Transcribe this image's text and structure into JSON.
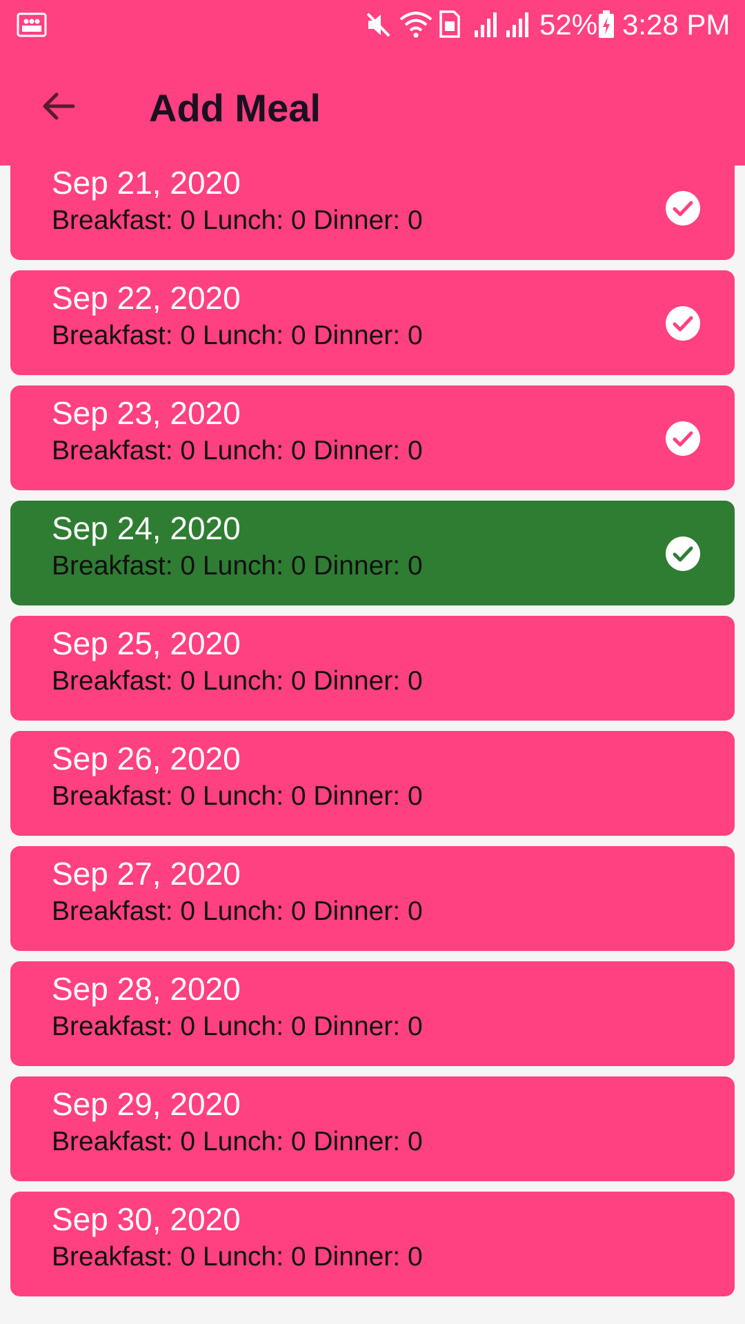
{
  "status_bar": {
    "battery": "52%",
    "time": "3:28 PM",
    "icons": [
      "photo-notification-icon",
      "mute-icon",
      "wifi-icon",
      "sim-icon",
      "signal-icon",
      "signal-icon",
      "battery-charging-icon"
    ]
  },
  "app_bar": {
    "title": "Add Meal",
    "back_icon": "arrow-back-icon"
  },
  "colors": {
    "accent": "#ff4081",
    "selected": "#2e7d32",
    "text_dark": "#111111",
    "text_light": "#ffffff"
  },
  "days": [
    {
      "date": "Sep 21, 2020",
      "meals": "Breakfast: 0 Lunch: 0 Dinner: 0",
      "checked": true,
      "selected": false
    },
    {
      "date": "Sep 22, 2020",
      "meals": "Breakfast: 0 Lunch: 0 Dinner: 0",
      "checked": true,
      "selected": false
    },
    {
      "date": "Sep 23, 2020",
      "meals": "Breakfast: 0 Lunch: 0 Dinner: 0",
      "checked": true,
      "selected": false
    },
    {
      "date": "Sep 24, 2020",
      "meals": "Breakfast: 0 Lunch: 0 Dinner: 0",
      "checked": true,
      "selected": true
    },
    {
      "date": "Sep 25, 2020",
      "meals": "Breakfast: 0 Lunch: 0 Dinner: 0",
      "checked": false,
      "selected": false
    },
    {
      "date": "Sep 26, 2020",
      "meals": "Breakfast: 0 Lunch: 0 Dinner: 0",
      "checked": false,
      "selected": false
    },
    {
      "date": "Sep 27, 2020",
      "meals": "Breakfast: 0 Lunch: 0 Dinner: 0",
      "checked": false,
      "selected": false
    },
    {
      "date": "Sep 28, 2020",
      "meals": "Breakfast: 0 Lunch: 0 Dinner: 0",
      "checked": false,
      "selected": false
    },
    {
      "date": "Sep 29, 2020",
      "meals": "Breakfast: 0 Lunch: 0 Dinner: 0",
      "checked": false,
      "selected": false
    },
    {
      "date": "Sep 30, 2020",
      "meals": "Breakfast: 0 Lunch: 0 Dinner: 0",
      "checked": false,
      "selected": false
    }
  ]
}
